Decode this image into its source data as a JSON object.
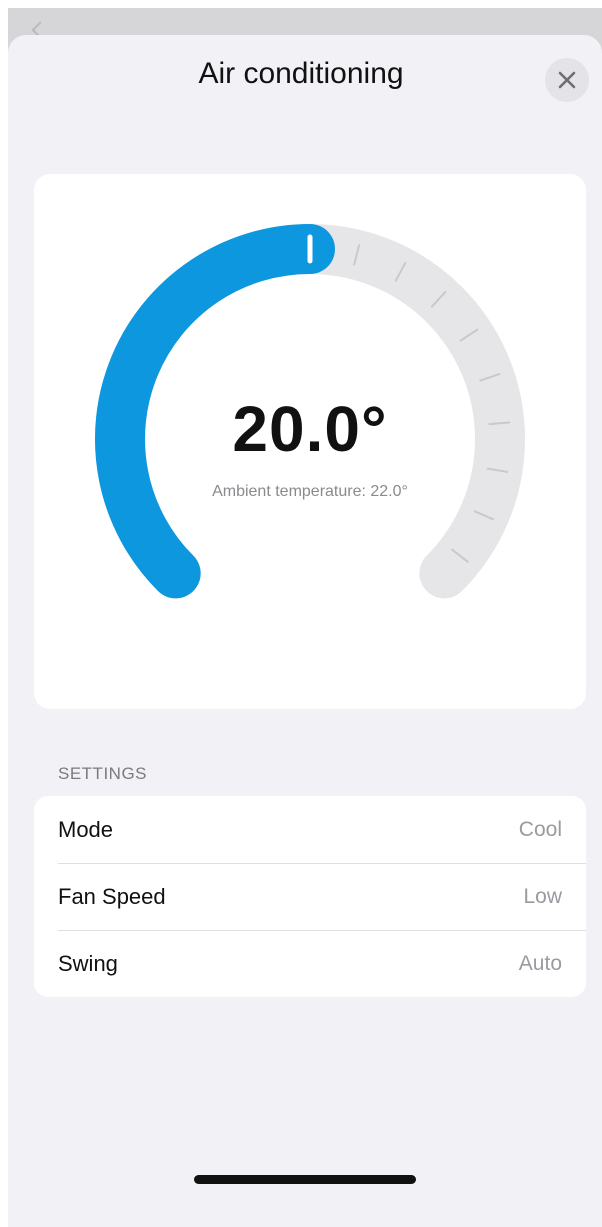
{
  "sheet": {
    "title": "Air conditioning",
    "close_icon": "close-icon"
  },
  "thermostat": {
    "target_temperature": "20.0°",
    "ambient_label": "Ambient temperature: 22.0°",
    "setpoint_fraction": 0.5,
    "colors": {
      "active_arc": "#0d97df",
      "inactive_arc": "#e6e6e8",
      "ticks": "#c9c9cc",
      "knob": "#ffffff"
    }
  },
  "settings": {
    "header": "SETTINGS",
    "rows": [
      {
        "label": "Mode",
        "value": "Cool"
      },
      {
        "label": "Fan Speed",
        "value": "Low"
      },
      {
        "label": "Swing",
        "value": "Auto"
      }
    ]
  }
}
